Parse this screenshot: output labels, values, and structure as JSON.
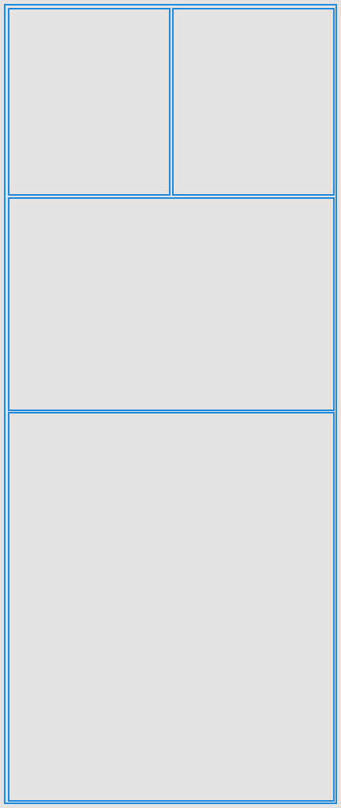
{
  "theme": {
    "background": "#e3e3e3",
    "accent": "#1a8be0"
  },
  "layout": {
    "panes": [
      {
        "id": "top-left",
        "content": ""
      },
      {
        "id": "top-right",
        "content": ""
      },
      {
        "id": "middle",
        "content": ""
      },
      {
        "id": "bottom",
        "content": ""
      }
    ]
  }
}
